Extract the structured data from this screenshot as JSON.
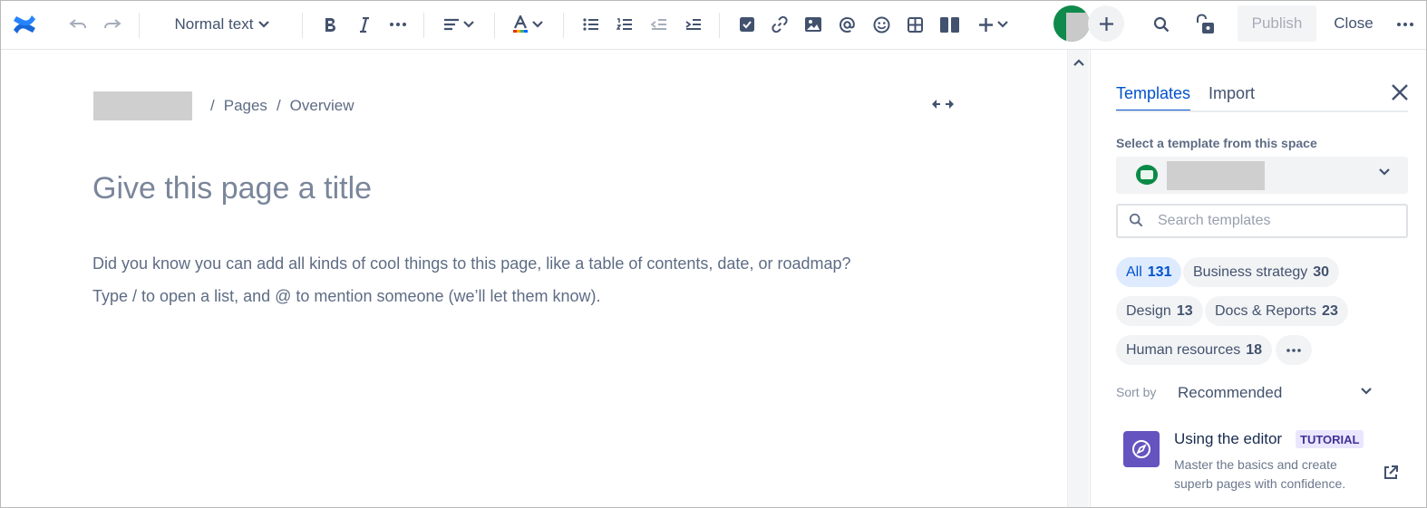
{
  "toolbar": {
    "text_style": "Normal text",
    "publish_label": "Publish",
    "close_label": "Close"
  },
  "editor": {
    "breadcrumb": [
      "Pages",
      "Overview"
    ],
    "title_placeholder": "Give this page a title",
    "body_placeholder_line1": "Did you know you can add all kinds of cool things to this page, like a table of contents, date, or roadmap?",
    "body_placeholder_line2": "Type / to open a list, and @ to mention someone (we’ll let them know)."
  },
  "panel": {
    "tabs": [
      {
        "label": "Templates",
        "active": true
      },
      {
        "label": "Import",
        "active": false
      }
    ],
    "select_label": "Select a template from this space",
    "search_placeholder": "Search templates",
    "chips": [
      {
        "label": "All",
        "count": "131",
        "active": true
      },
      {
        "label": "Business strategy",
        "count": "30",
        "active": false
      },
      {
        "label": "Design",
        "count": "13",
        "active": false
      },
      {
        "label": "Docs & Reports",
        "count": "23",
        "active": false
      },
      {
        "label": "Human resources",
        "count": "18",
        "active": false
      }
    ],
    "sort_label": "Sort by",
    "sort_value": "Recommended",
    "template": {
      "name": "Using the editor",
      "badge": "TUTORIAL",
      "description": "Master the basics and create superb pages with confidence."
    }
  },
  "colors": {
    "brand_blue": "#0052CC",
    "template_icon": "#6554C0",
    "avatar_green": "#0e8a4c"
  },
  "icons": [
    "confluence-logo-icon",
    "undo-icon",
    "redo-icon",
    "bold-icon",
    "italic-icon",
    "more-icon",
    "align-icon",
    "text-color-icon",
    "bullet-list-icon",
    "numbered-list-icon",
    "outdent-icon",
    "indent-icon",
    "action-item-icon",
    "link-icon",
    "image-icon",
    "mention-icon",
    "emoji-icon",
    "table-icon",
    "layout-icon",
    "insert-icon",
    "search-icon",
    "restrictions-icon",
    "close-icon",
    "compass-icon",
    "external-link-icon"
  ]
}
